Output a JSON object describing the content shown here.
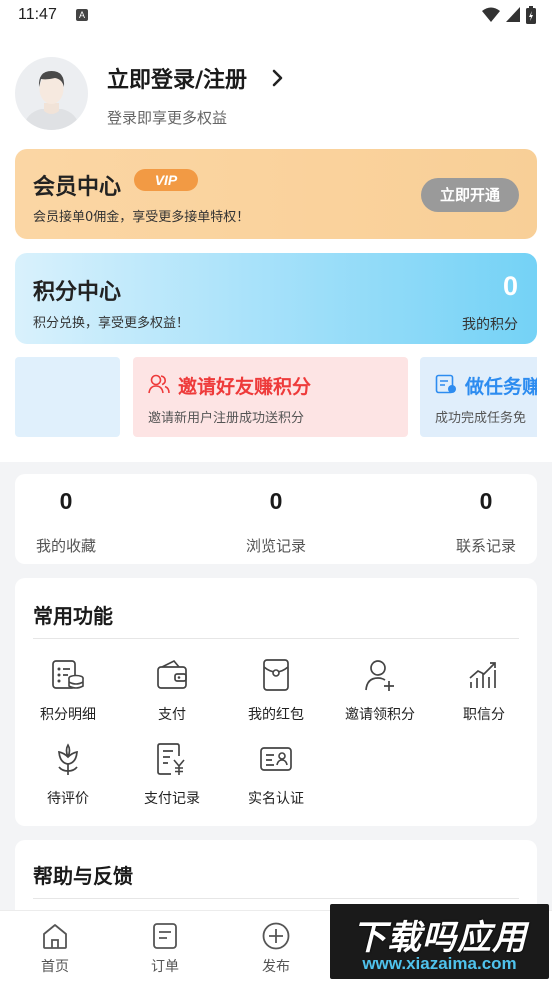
{
  "status_bar": {
    "time": "11:47",
    "notification_badge": "A"
  },
  "profile": {
    "login_title": "立即登录/注册",
    "login_subtitle": "登录即享更多权益"
  },
  "vip_card": {
    "title": "会员中心",
    "badge": "VIP",
    "description": "会员接单0佣金，享受更多接单特权！",
    "button": "立即开通"
  },
  "points_card": {
    "title": "积分中心",
    "description": "积分兑换，享受更多权益！",
    "value": "0",
    "value_label": "我的积分"
  },
  "promos": [
    {
      "title": "邀请好友赚积分",
      "description": "邀请新用户注册成功送积分",
      "icon": "users-icon",
      "color": "#ee3a3a"
    },
    {
      "title": "做任务赚",
      "description": "成功完成任务免",
      "icon": "task-card-icon",
      "color": "#2d8cf0"
    }
  ],
  "stats": [
    {
      "value": "0",
      "label": "我的收藏"
    },
    {
      "value": "0",
      "label": "浏览记录"
    },
    {
      "value": "0",
      "label": "联系记录"
    }
  ],
  "functions": {
    "title": "常用功能",
    "items": [
      {
        "label": "积分明细",
        "icon": "points-detail-icon"
      },
      {
        "label": "支付",
        "icon": "wallet-icon"
      },
      {
        "label": "我的红包",
        "icon": "red-packet-icon"
      },
      {
        "label": "邀请领积分",
        "icon": "invite-user-icon"
      },
      {
        "label": "职信分",
        "icon": "credit-chart-icon"
      },
      {
        "label": "待评价",
        "icon": "flower-icon"
      },
      {
        "label": "支付记录",
        "icon": "payment-record-icon"
      },
      {
        "label": "实名认证",
        "icon": "id-card-icon"
      }
    ]
  },
  "help": {
    "title": "帮助与反馈"
  },
  "tab_bar": {
    "items": [
      {
        "label": "首页",
        "icon": "home-icon"
      },
      {
        "label": "订单",
        "icon": "order-icon"
      },
      {
        "label": "发布",
        "icon": "plus-circle-icon"
      }
    ]
  },
  "watermark": {
    "top": "下载吗应用",
    "bottom": "www.xiazaima.com"
  }
}
